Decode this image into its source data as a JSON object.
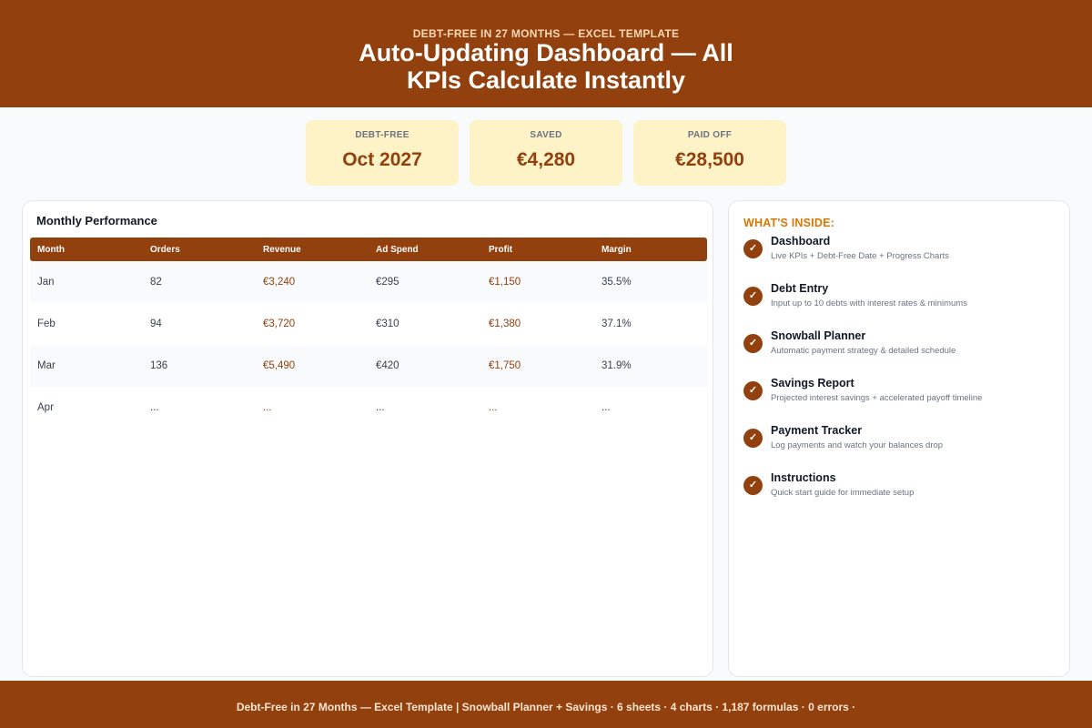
{
  "header": {
    "eyebrow": "DEBT-FREE IN 27 MONTHS — EXCEL TEMPLATE",
    "title": "Auto-Updating Dashboard — All KPIs Calculate Instantly"
  },
  "kpis": [
    {
      "label": "DEBT-FREE",
      "value": "Oct 2027"
    },
    {
      "label": "SAVED",
      "value": "€4,280"
    },
    {
      "label": "PAID OFF",
      "value": "€28,500"
    }
  ],
  "performance": {
    "title": "Monthly Performance",
    "columns": [
      "Month",
      "Orders",
      "Revenue",
      "Ad Spend",
      "Profit",
      "Margin"
    ],
    "rows": [
      [
        "Jan",
        "82",
        "€3,240",
        "€295",
        "€1,150",
        "35.5%"
      ],
      [
        "Feb",
        "94",
        "€3,720",
        "€310",
        "€1,380",
        "37.1%"
      ],
      [
        "Mar",
        "136",
        "€5,490",
        "€420",
        "€1,750",
        "31.9%"
      ],
      [
        "Apr",
        "...",
        "...",
        "...",
        "...",
        "..."
      ]
    ]
  },
  "inside": {
    "title": "WHAT'S INSIDE:",
    "check_glyph": "✓",
    "items": [
      {
        "name": "Dashboard",
        "desc": "Live KPIs + Debt-Free Date + Progress Charts"
      },
      {
        "name": "Debt Entry",
        "desc": "Input up to 10 debts with interest rates & minimums"
      },
      {
        "name": "Snowball Planner",
        "desc": "Automatic payment strategy & detailed schedule"
      },
      {
        "name": "Savings Report",
        "desc": "Projected interest savings + accelerated payoff timeline"
      },
      {
        "name": "Payment Tracker",
        "desc": "Log payments and watch your balances drop"
      },
      {
        "name": "Instructions",
        "desc": "Quick start guide for immediate setup"
      }
    ]
  },
  "footer": {
    "text": "Debt-Free in 27 Months — Excel Template | Snowball Planner + Savings · 6 sheets · 4 charts · 1,187 formulas · 0 errors ·"
  },
  "colors": {
    "brand": "#92400e",
    "kpi_bg": "#fef3c7",
    "inside_title": "#d97706"
  }
}
